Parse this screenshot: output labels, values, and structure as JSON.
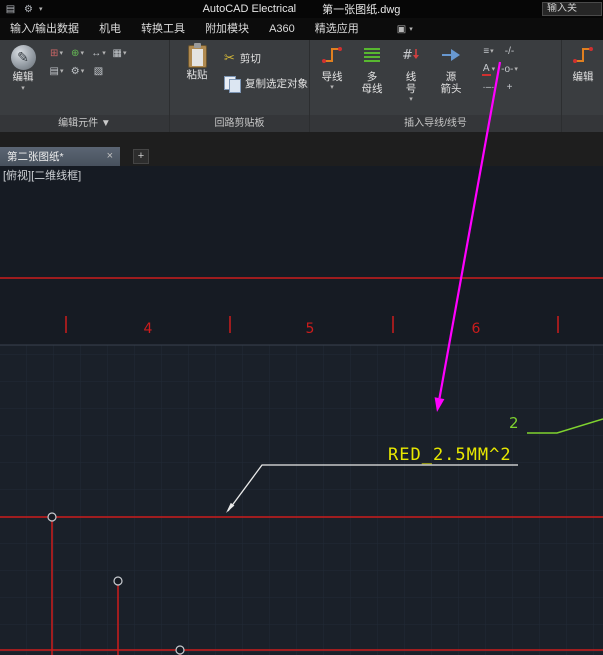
{
  "titlebar": {
    "app_title": "AutoCAD Electrical",
    "doc_title": "第一张图纸.dwg",
    "search_value": "输入关"
  },
  "menubar": {
    "items": [
      "输入/输出数据",
      "机电",
      "转换工具",
      "附加模块",
      "A360",
      "精选应用"
    ]
  },
  "ribbon": {
    "edit_components": {
      "label": "编辑元件 ▼",
      "edit": "编辑"
    },
    "clipboard": {
      "label": "回路剪贴板",
      "paste": "粘贴",
      "cut": "剪切",
      "copy": "复制选定对象"
    },
    "wires": {
      "label": "插入导线/线号",
      "wire": "导线",
      "multibus_l1": "多",
      "multibus_l2": "母线",
      "wirenum_l1": "线",
      "wirenum_l2": "号",
      "srcarrow_l1": "源",
      "srcarrow_l2": "箭头"
    },
    "edit_wires": {
      "edit": "编辑"
    }
  },
  "tabbar": {
    "drawing_tab": "第二张图纸*",
    "close": "×",
    "new_tab": "+"
  },
  "canvas": {
    "viewport_label": "[俯视][二维线框]",
    "ruler": {
      "n4": "4",
      "n5": "5",
      "n6": "6"
    },
    "wire_number": "2",
    "wire_label": "RED_2.5MM^2"
  },
  "colors": {
    "wire_red": "#cc1c1c",
    "magenta": "#ff00ff",
    "green": "#7fd22f",
    "yellow": "#e8e800",
    "leader_white": "#e9e9e9",
    "ring_gray": "#c9ccd1"
  }
}
